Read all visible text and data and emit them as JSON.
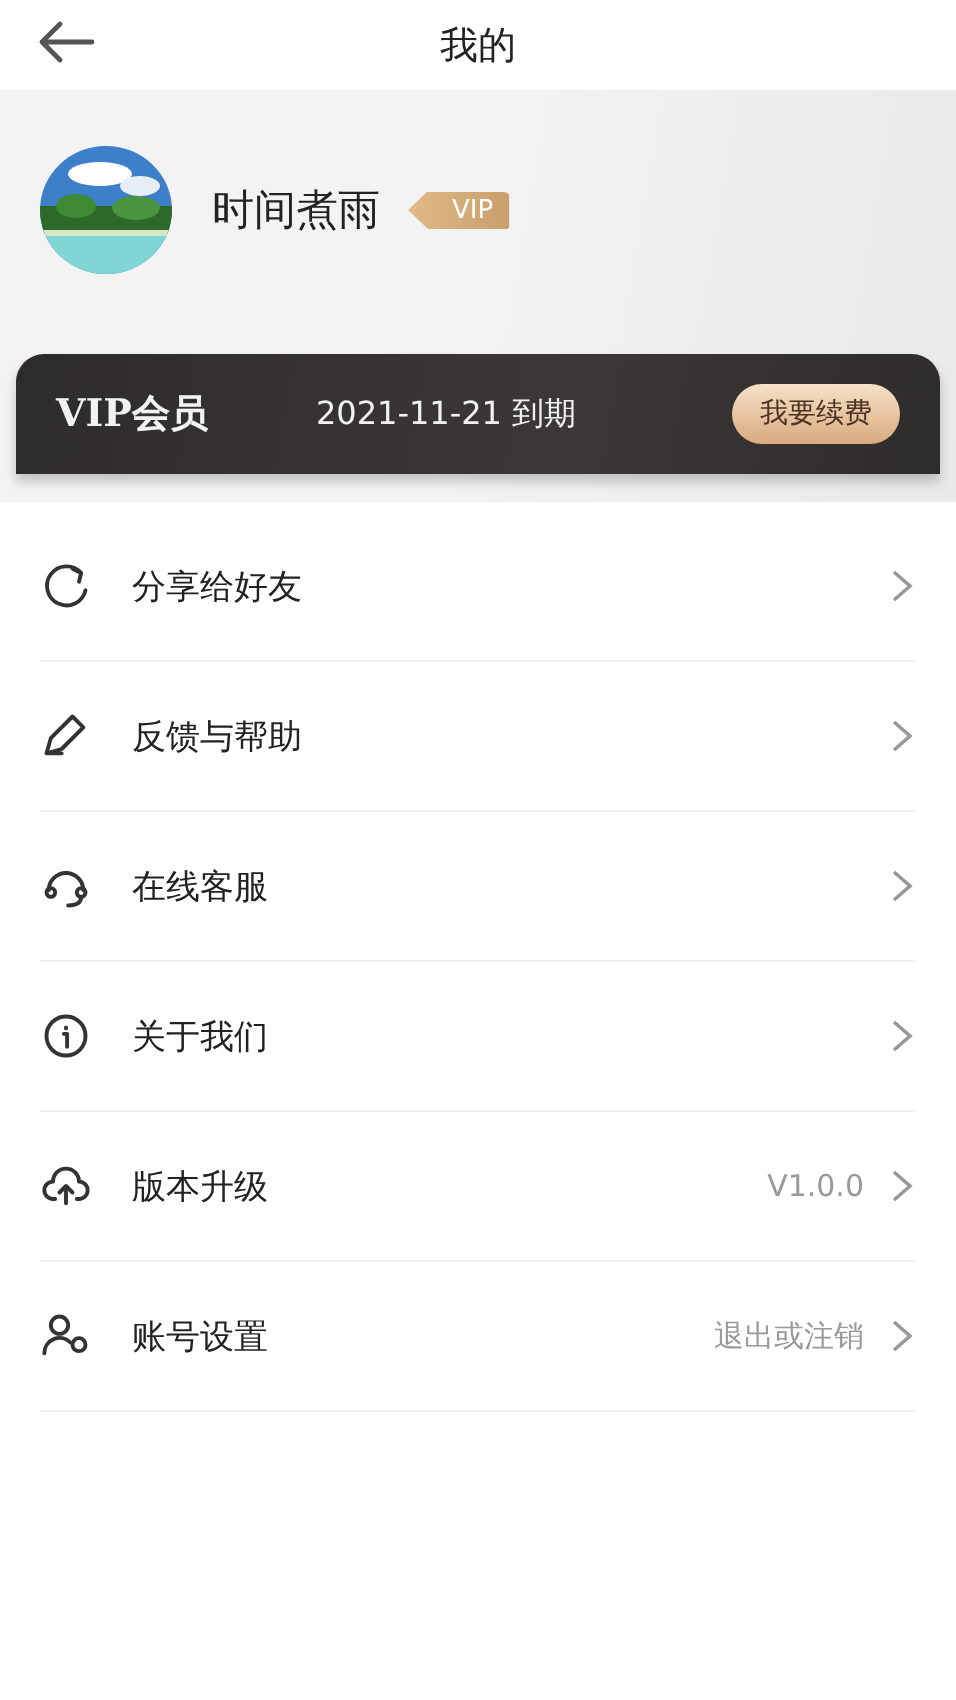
{
  "title": "我的",
  "profile": {
    "name": "时间煮雨",
    "badge": "VIP"
  },
  "vip_card": {
    "label": "VIP会员",
    "expiry": "2021-11-21 到期",
    "button": "我要续费"
  },
  "menu": [
    {
      "label": "分享给好友"
    },
    {
      "label": "反馈与帮助"
    },
    {
      "label": "在线客服"
    },
    {
      "label": "关于我们"
    },
    {
      "label": "版本升级",
      "value": "V1.0.0"
    },
    {
      "label": "账号设置",
      "value": "退出或注销"
    }
  ]
}
